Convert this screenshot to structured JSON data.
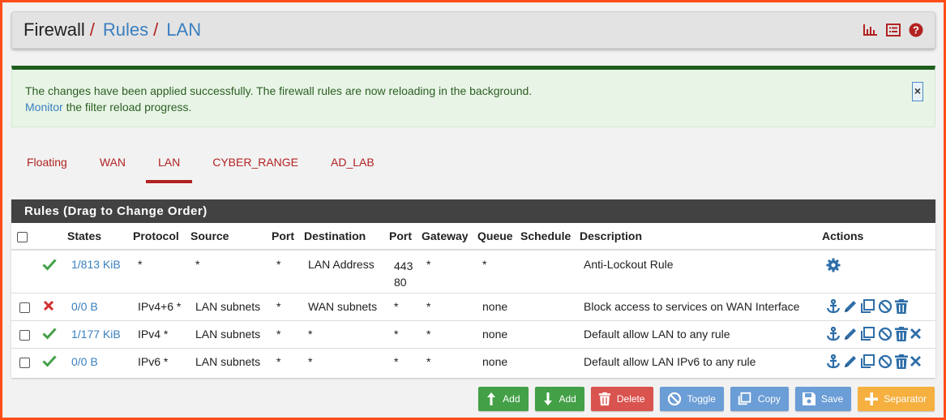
{
  "breadcrumb": {
    "items": [
      "Firewall",
      "Rules",
      "LAN"
    ],
    "separator": "/"
  },
  "header_icons": [
    "chart-icon",
    "list-icon",
    "help-icon"
  ],
  "alert": {
    "line1": "The changes have been applied successfully. The firewall rules are now reloading in the background.",
    "link": "Monitor",
    "line2_rest": " the filter reload progress.",
    "close": "×"
  },
  "tabs": [
    {
      "label": "Floating",
      "active": false
    },
    {
      "label": "WAN",
      "active": false
    },
    {
      "label": "LAN",
      "active": true
    },
    {
      "label": "CYBER_RANGE",
      "active": false
    },
    {
      "label": "AD_LAB",
      "active": false
    }
  ],
  "panel": {
    "title": "Rules (Drag to Change Order)",
    "columns": [
      "",
      "",
      "States",
      "Protocol",
      "Source",
      "Port",
      "Destination",
      "Port",
      "Gateway",
      "Queue",
      "Schedule",
      "Description",
      "Actions"
    ],
    "rows": [
      {
        "checkbox": false,
        "status": "pass",
        "states": "1/813 KiB",
        "protocol": "*",
        "source": "*",
        "sport": "*",
        "destination": "LAN Address",
        "dport_l1": "443",
        "dport_l2": "80",
        "gateway": "*",
        "queue": "*",
        "schedule": "",
        "description": "Anti-Lockout Rule",
        "actions": [
          "gear-icon"
        ]
      },
      {
        "checkbox": true,
        "status": "block",
        "states": "0/0 B",
        "protocol": "IPv4+6 *",
        "source": "LAN subnets",
        "sport": "*",
        "destination": "WAN subnets",
        "dport": "*",
        "gateway": "*",
        "queue": "none",
        "schedule": "",
        "description": "Block access to services on WAN Interface",
        "actions": [
          "anchor-icon",
          "pencil-icon",
          "copy-icon",
          "disable-icon",
          "trash-icon"
        ]
      },
      {
        "checkbox": true,
        "status": "pass",
        "states": "1/177 KiB",
        "protocol": "IPv4 *",
        "source": "LAN subnets",
        "sport": "*",
        "destination": "*",
        "dport": "*",
        "gateway": "*",
        "queue": "none",
        "schedule": "",
        "description": "Default allow LAN to any rule",
        "actions": [
          "anchor-icon",
          "pencil-icon",
          "copy-icon",
          "disable-icon",
          "trash-icon",
          "close-icon"
        ]
      },
      {
        "checkbox": true,
        "status": "pass",
        "states": "0/0 B",
        "protocol": "IPv6 *",
        "source": "LAN subnets",
        "sport": "*",
        "destination": "*",
        "dport": "*",
        "gateway": "*",
        "queue": "none",
        "schedule": "",
        "description": "Default allow LAN IPv6 to any rule",
        "actions": [
          "anchor-icon",
          "pencil-icon",
          "copy-icon",
          "disable-icon",
          "trash-icon",
          "close-icon"
        ]
      }
    ]
  },
  "buttons": [
    {
      "label": "Add",
      "icon": "add-top-icon",
      "color": "green"
    },
    {
      "label": "Add",
      "icon": "add-bottom-icon",
      "color": "green"
    },
    {
      "label": "Delete",
      "icon": "trash-icon",
      "color": "red"
    },
    {
      "label": "Toggle",
      "icon": "disable-icon",
      "color": "blue"
    },
    {
      "label": "Copy",
      "icon": "copy-icon",
      "color": "blue"
    },
    {
      "label": "Save",
      "icon": "save-icon",
      "color": "blue"
    },
    {
      "label": "Separator",
      "icon": "plus-icon",
      "color": "orange"
    }
  ],
  "colors": {
    "accent_red": "#b22222",
    "link_blue": "#3a7fbf",
    "pass_green": "#43a047",
    "block_red": "#d32f2f",
    "action_blue": "#2e6ea8"
  }
}
